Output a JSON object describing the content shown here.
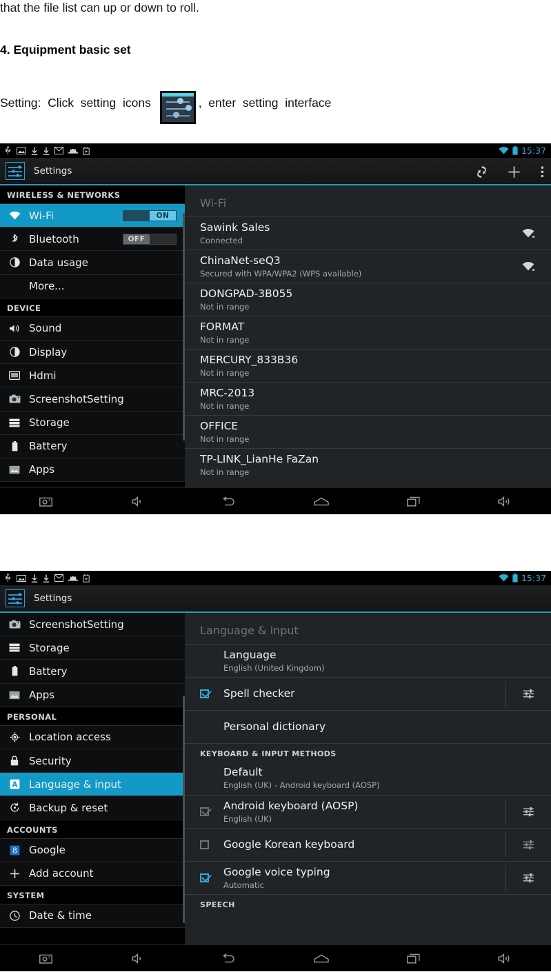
{
  "document": {
    "intro_line": "that the file list can up or down to roll.",
    "heading": "4. Equipment basic set",
    "setting_prefix": "Setting:  Click  setting  icons ",
    "setting_suffix": ",  enter  setting  interface",
    "inline_icon": "settings-app-icon"
  },
  "statusbar": {
    "left_icons": [
      "usb-icon",
      "image-icon",
      "download-icon",
      "download-icon",
      "mail-icon",
      "adb-icon",
      "play-store-icon"
    ],
    "right_icons": [
      "wifi-icon",
      "battery-icon"
    ],
    "clock": "15:37",
    "accent_color": "#2badd4"
  },
  "screen_wifi": {
    "actionbar": {
      "app_icon": "settings-app-icon",
      "title": "Settings",
      "actions": [
        {
          "name": "scan-button",
          "icon": "scan-icon"
        },
        {
          "name": "add-network-button",
          "icon": "plus-icon"
        },
        {
          "name": "overflow-menu-button",
          "icon": "overflow-menu-icon"
        }
      ]
    },
    "sidebar": [
      {
        "type": "header",
        "label": "WIRELESS & NETWORKS"
      },
      {
        "type": "item",
        "label": "Wi-Fi",
        "icon": "wifi-icon",
        "selected": true,
        "toggle": "ON"
      },
      {
        "type": "item",
        "label": "Bluetooth",
        "icon": "bluetooth-icon",
        "selected": false,
        "toggle": "OFF"
      },
      {
        "type": "item",
        "label": "Data usage",
        "icon": "data-usage-icon",
        "selected": false
      },
      {
        "type": "item",
        "label": "More...",
        "icon": "",
        "selected": false
      },
      {
        "type": "header",
        "label": "DEVICE"
      },
      {
        "type": "item",
        "label": "Sound",
        "icon": "sound-icon",
        "selected": false
      },
      {
        "type": "item",
        "label": "Display",
        "icon": "display-icon",
        "selected": false
      },
      {
        "type": "item",
        "label": "Hdmi",
        "icon": "hdmi-icon",
        "selected": false
      },
      {
        "type": "item",
        "label": "ScreenshotSetting",
        "icon": "camera-icon",
        "selected": false
      },
      {
        "type": "item",
        "label": "Storage",
        "icon": "storage-icon",
        "selected": false
      },
      {
        "type": "item",
        "label": "Battery",
        "icon": "battery-icon",
        "selected": false
      },
      {
        "type": "item",
        "label": "Apps",
        "icon": "apps-icon",
        "selected": false
      }
    ],
    "content_title": "Wi-Fi",
    "networks": [
      {
        "ssid": "Sawink Sales",
        "status": "Connected",
        "signal": "wifi-signal-icon"
      },
      {
        "ssid": "ChinaNet-seQ3",
        "status": "Secured with WPA/WPA2 (WPS available)",
        "signal": "wifi-signal-lock-icon"
      },
      {
        "ssid": "DONGPAD-3B055",
        "status": "Not in range",
        "signal": ""
      },
      {
        "ssid": "FORMAT",
        "status": "Not in range",
        "signal": ""
      },
      {
        "ssid": "MERCURY_833B36",
        "status": "Not in range",
        "signal": ""
      },
      {
        "ssid": "MRC-2013",
        "status": "Not in range",
        "signal": ""
      },
      {
        "ssid": "OFFICE",
        "status": "Not in range",
        "signal": ""
      },
      {
        "ssid": "TP-LINK_LianHe FaZan",
        "status": "Not in range",
        "signal": ""
      }
    ]
  },
  "screen_language": {
    "actionbar": {
      "app_icon": "settings-app-icon",
      "title": "Settings",
      "actions": []
    },
    "sidebar": [
      {
        "type": "item",
        "label": "ScreenshotSetting",
        "icon": "camera-icon",
        "selected": false
      },
      {
        "type": "item",
        "label": "Storage",
        "icon": "storage-icon",
        "selected": false
      },
      {
        "type": "item",
        "label": "Battery",
        "icon": "battery-icon",
        "selected": false
      },
      {
        "type": "item",
        "label": "Apps",
        "icon": "apps-icon",
        "selected": false
      },
      {
        "type": "header",
        "label": "PERSONAL"
      },
      {
        "type": "item",
        "label": "Location access",
        "icon": "location-icon",
        "selected": false
      },
      {
        "type": "item",
        "label": "Security",
        "icon": "lock-icon",
        "selected": false
      },
      {
        "type": "item",
        "label": "Language & input",
        "icon": "language-icon",
        "selected": true
      },
      {
        "type": "item",
        "label": "Backup & reset",
        "icon": "backup-icon",
        "selected": false
      },
      {
        "type": "header",
        "label": "ACCOUNTS"
      },
      {
        "type": "item",
        "label": "Google",
        "icon": "google-icon",
        "selected": false
      },
      {
        "type": "item",
        "label": "Add account",
        "icon": "plus-icon",
        "selected": false
      },
      {
        "type": "header",
        "label": "SYSTEM"
      },
      {
        "type": "item",
        "label": "Date & time",
        "icon": "clock-icon",
        "selected": false
      }
    ],
    "content_title": "Language & input",
    "rows": [
      {
        "kind": "row",
        "title": "Language",
        "sub": "English (United Kingdom)",
        "checkbox": "none",
        "settings_icon": false
      },
      {
        "kind": "row",
        "title": "Spell checker",
        "sub": "",
        "checkbox": "checked",
        "settings_icon": true
      },
      {
        "kind": "row",
        "title": "Personal dictionary",
        "sub": "",
        "checkbox": "none",
        "settings_icon": false
      },
      {
        "kind": "section",
        "title": "KEYBOARD & INPUT METHODS"
      },
      {
        "kind": "row",
        "title": "Default",
        "sub": "English (UK) - Android keyboard (AOSP)",
        "checkbox": "none",
        "settings_icon": false
      },
      {
        "kind": "row",
        "title": "Android keyboard (AOSP)",
        "sub": "English (UK)",
        "checkbox": "checked-disabled",
        "settings_icon": true
      },
      {
        "kind": "row",
        "title": "Google Korean keyboard",
        "sub": "",
        "checkbox": "unchecked",
        "settings_icon": true
      },
      {
        "kind": "row",
        "title": "Google voice typing",
        "sub": "Automatic",
        "checkbox": "checked",
        "settings_icon": true
      },
      {
        "kind": "section",
        "title": "SPEECH"
      }
    ]
  },
  "navbar": {
    "buttons": [
      {
        "name": "screenshot-button",
        "icon": "camera-icon"
      },
      {
        "name": "volume-down-button",
        "icon": "volume-down-icon"
      },
      {
        "name": "back-button",
        "icon": "back-icon"
      },
      {
        "name": "home-button",
        "icon": "home-icon"
      },
      {
        "name": "recents-button",
        "icon": "recents-icon"
      },
      {
        "name": "volume-up-button",
        "icon": "volume-up-icon"
      }
    ]
  },
  "colors": {
    "accent": "#1399c6",
    "status_accent": "#2badd4",
    "content_bg": "#212426"
  }
}
